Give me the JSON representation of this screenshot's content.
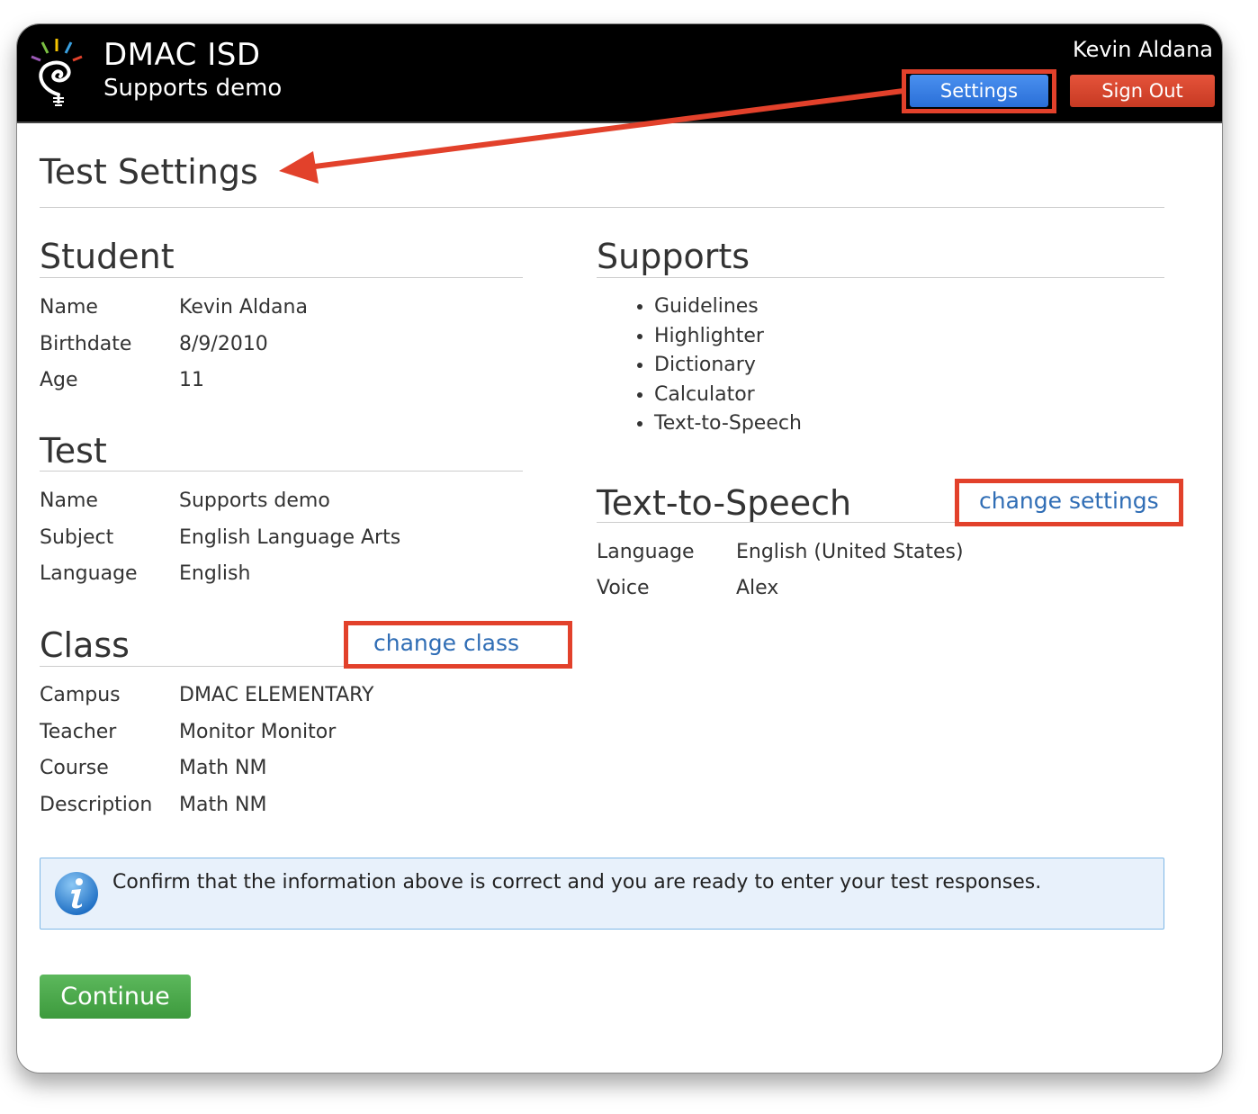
{
  "header": {
    "org_name": "DMAC ISD",
    "test_name": "Supports demo",
    "user_name": "Kevin Aldana",
    "settings_label": "Settings",
    "signout_label": "Sign Out"
  },
  "page": {
    "title": "Test Settings"
  },
  "student": {
    "heading": "Student",
    "rows": [
      {
        "label": "Name",
        "value": "Kevin Aldana"
      },
      {
        "label": "Birthdate",
        "value": "8/9/2010"
      },
      {
        "label": "Age",
        "value": "11"
      }
    ]
  },
  "test": {
    "heading": "Test",
    "rows": [
      {
        "label": "Name",
        "value": "Supports demo"
      },
      {
        "label": "Subject",
        "value": "English Language Arts"
      },
      {
        "label": "Language",
        "value": "English"
      }
    ]
  },
  "class": {
    "heading": "Class",
    "change_link": "change class",
    "rows": [
      {
        "label": "Campus",
        "value": "DMAC ELEMENTARY"
      },
      {
        "label": "Teacher",
        "value": "Monitor Monitor"
      },
      {
        "label": "Course",
        "value": "Math NM"
      },
      {
        "label": "Description",
        "value": "Math NM"
      }
    ]
  },
  "supports": {
    "heading": "Supports",
    "items": [
      "Guidelines",
      "Highlighter",
      "Dictionary",
      "Calculator",
      "Text-to-Speech"
    ]
  },
  "tts": {
    "heading": "Text-to-Speech",
    "change_link": "change settings",
    "rows": [
      {
        "label": "Language",
        "value": "English (United States)"
      },
      {
        "label": "Voice",
        "value": "Alex"
      }
    ]
  },
  "info": {
    "message": "Confirm that the information above is correct and you are ready to enter your test responses."
  },
  "actions": {
    "continue_label": "Continue"
  },
  "colors": {
    "settings_button": "#2a6fd8",
    "signout_button": "#c73a23",
    "continue_button": "#3d9a3d",
    "link": "#2f6db5",
    "annotation": "#e2412b"
  }
}
